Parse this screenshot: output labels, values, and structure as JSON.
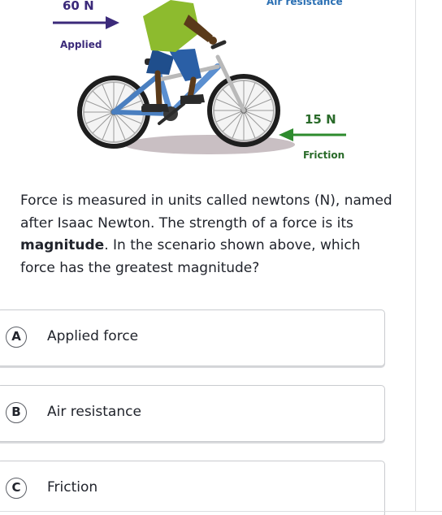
{
  "illustration": {
    "applied": {
      "value": "60 N",
      "name": "Applied"
    },
    "air": {
      "name": "Air resistance"
    },
    "friction": {
      "value": "15 N",
      "name": "Friction"
    }
  },
  "question": {
    "text_before": "Force is measured in units called newtons (N), named after Isaac Newton. The strength of a force is its ",
    "bold_term": "magnitude",
    "text_after": ". In the scenario shown above, which force has the greatest magnitude?"
  },
  "choices": [
    {
      "letter": "A",
      "label": "Applied force"
    },
    {
      "letter": "B",
      "label": "Air resistance"
    },
    {
      "letter": "C",
      "label": "Friction"
    }
  ],
  "colors": {
    "applied_arrow": "#3b2a7a",
    "friction_arrow": "#2e8b2e",
    "air_label": "#2a6fb3",
    "text": "#21242c",
    "border": "#c9cbcf"
  }
}
